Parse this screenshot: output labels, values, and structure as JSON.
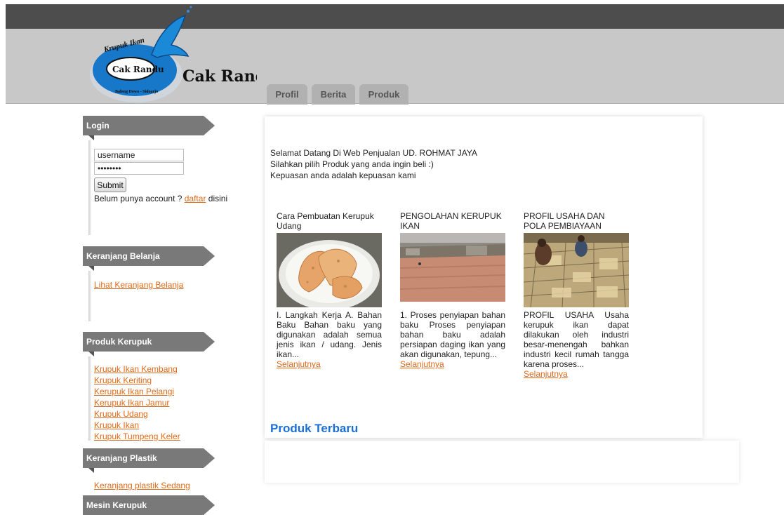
{
  "header": {
    "logo_text_arc": "Krupuk Ikan",
    "logo_text_oval": "Cak Randu",
    "logo_text_big": "Cak Randu",
    "logo_text_small": "Balong Dowo - Sidoarjo"
  },
  "tabs": [
    {
      "label": "Profil"
    },
    {
      "label": "Berita"
    },
    {
      "label": "Produk"
    }
  ],
  "sidebar": {
    "login": {
      "title": "Login",
      "username_value": "username",
      "password_value": "password",
      "submit_label": "Submit",
      "register_prefix": "Belum punya account ? ",
      "register_link": "daftar",
      "register_suffix": " disini"
    },
    "cart": {
      "title": "Keranjang Belanja",
      "link": "Lihat Keranjang Belanja"
    },
    "products": {
      "title": "Produk Kerupuk",
      "items": [
        "Krupuk Ikan Kembang",
        "Krupuk Keriting",
        "Kerupuk Ikan Pelangi",
        "Kerupuk Ikan Jamur",
        "Krupuk Udang",
        "Krupuk Ikan",
        "Krupuk Tumpeng Keler"
      ]
    },
    "plastic": {
      "title": "Keranjang Plastik",
      "link": "Keranjang plastik Sedang"
    },
    "machine": {
      "title": "Mesin Kerupuk"
    }
  },
  "main": {
    "welcome": [
      "Selamat Datang Di Web Penjualan UD. ROHMAT JAYA",
      "Silahkan pilih Produk yang anda ingin beli :)",
      "Kepuasan anda adalah kepuasan kami"
    ],
    "articles": [
      {
        "title": "Cara Pembuatan Kerupuk Udang",
        "text": "I. Langkah Kerja A. Bahan Baku Bahan baku yang digunakan adalah semua jenis ikan / udang. Jenis ikan...",
        "more": "Selanjutnya"
      },
      {
        "title": "PENGOLAHAN KERUPUK IKAN",
        "text": "1. Proses penyiapan bahan baku Proses penyiapan bahan baku adalah persiapan daging ikan yang akan digunakan, tepung...",
        "more": "Selanjutnya"
      },
      {
        "title": "PROFIL USAHA DAN POLA PEMBIAYAAN",
        "text": "PROFIL USAHA Usaha kerupuk ikan dapat dilakukan oleh industri besar-menengah bahkan industri kecil rumah tangga karena proses...",
        "more": "Selanjutnya"
      }
    ],
    "section_title": "Produk Terbaru"
  },
  "colors": {
    "topbar": "#4d4d4d",
    "header": "#c8c8c8",
    "sidebar_head": "#797979",
    "link": "#e06a1a",
    "section_title": "#1a6fd6"
  }
}
